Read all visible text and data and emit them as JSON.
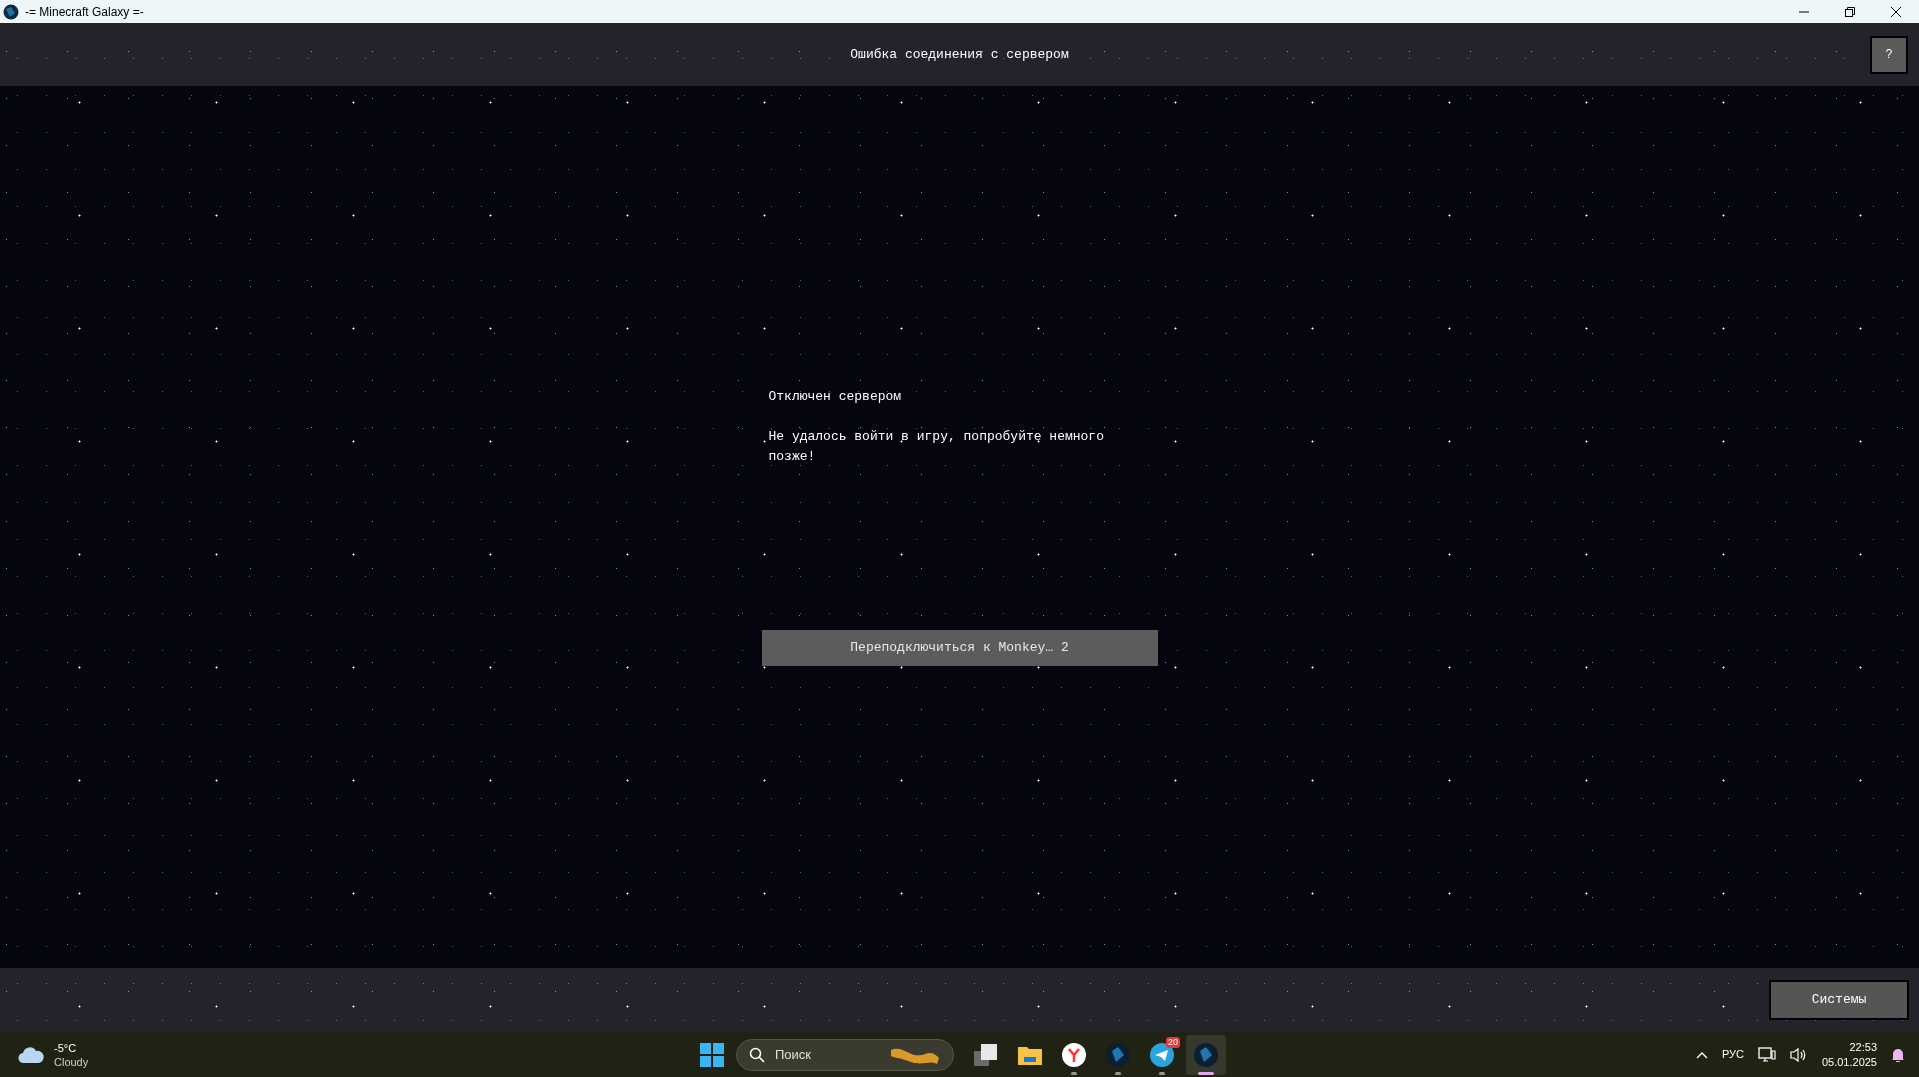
{
  "window": {
    "title": "-= Minecraft Galaxy =-"
  },
  "header": {
    "title": "Ошибка соединения с сервером",
    "help_button": "?"
  },
  "message": {
    "heading": "Отключен сервером",
    "body": "Не удалось войти в игру, попробуйте немного позже!"
  },
  "reconnect_button": "Переподключиться к Monkey… 2",
  "footer": {
    "systems_button": "Системы"
  },
  "taskbar": {
    "weather": {
      "temperature": "-5°C",
      "condition": "Cloudy"
    },
    "search": {
      "placeholder": "Поиск"
    },
    "apps": [
      {
        "kind": "task-view",
        "running": false,
        "active": false
      },
      {
        "kind": "folder",
        "running": false,
        "active": false
      },
      {
        "kind": "browser",
        "running": true,
        "active": false
      },
      {
        "kind": "globe",
        "running": true,
        "active": false
      },
      {
        "kind": "messenger",
        "running": true,
        "active": false,
        "badge": "20"
      },
      {
        "kind": "globe",
        "running": true,
        "active": true
      }
    ],
    "tray": {
      "language": "РУС",
      "time": "22:53",
      "date": "05.01.2025"
    }
  }
}
